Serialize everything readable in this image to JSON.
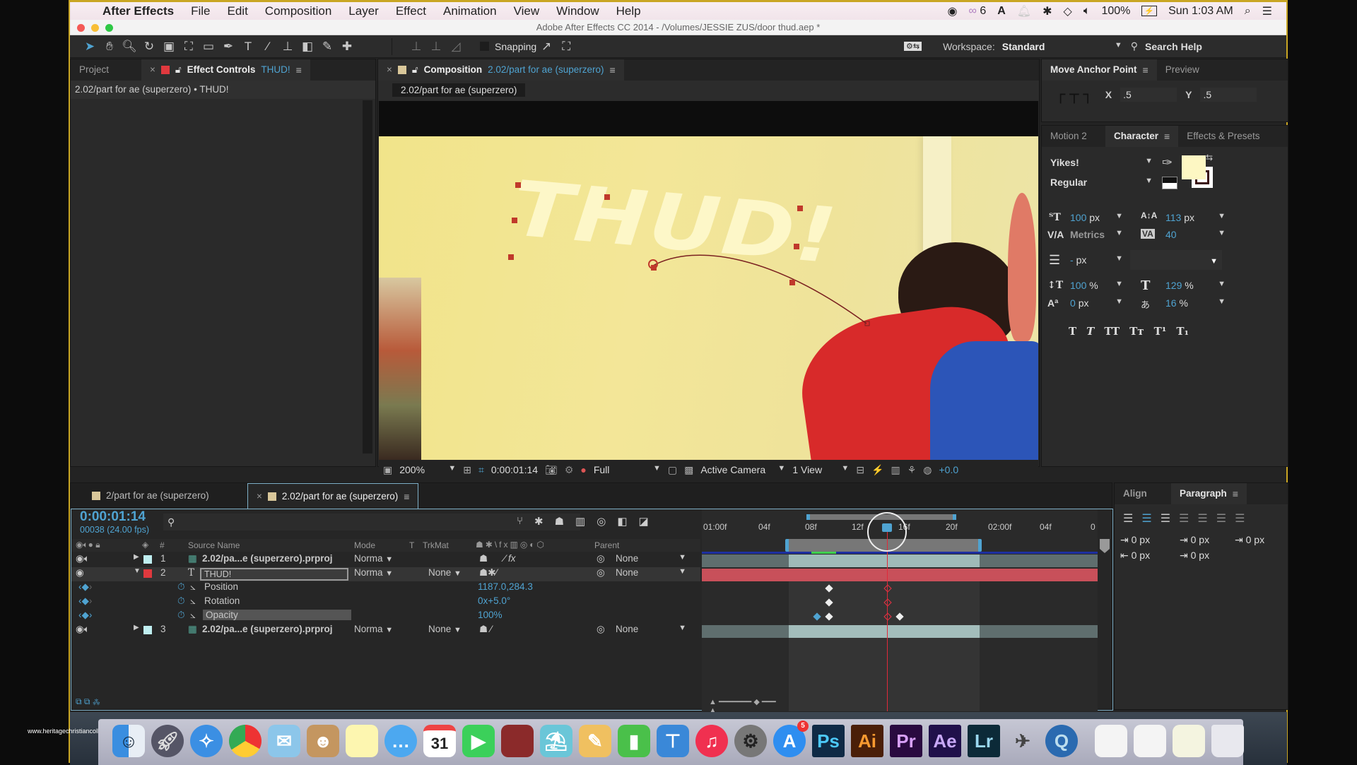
{
  "menubar": {
    "app_name": "After Effects",
    "items": [
      "File",
      "Edit",
      "Composition",
      "Layer",
      "Effect",
      "Animation",
      "View",
      "Window",
      "Help"
    ],
    "status": {
      "cc_count": "6",
      "battery": "100%",
      "clock": "Sun 1:03 AM"
    }
  },
  "window": {
    "title": "Adobe After Effects CC 2014 - /Volumes/JESSIE ZUS/door thud.aep *"
  },
  "toolbar": {
    "snapping_label": "Snapping",
    "workspace_label": "Workspace:",
    "workspace_value": "Standard",
    "search_help": "Search Help"
  },
  "left_panel": {
    "tab_project": "Project",
    "tab_effect_controls": "Effect Controls",
    "effect_controls_layer": "THUD!",
    "breadcrumb": "2.02/part for ae (superzero) • THUD!"
  },
  "composition": {
    "tab_label": "Composition",
    "comp_name": "2.02/part for ae (superzero)",
    "viewer_tab": "2.02/part for ae (superzero)",
    "overlay_text": "THUD!",
    "footer": {
      "zoom": "200%",
      "timecode": "0:00:01:14",
      "resolution": "Full",
      "camera": "Active Camera",
      "views": "1 View",
      "exposure": "+0.0"
    }
  },
  "right_panel": {
    "anchor_tab": "Move Anchor Point",
    "preview_tab": "Preview",
    "anchor_x_label": "X",
    "anchor_x": ".5",
    "anchor_y_label": "Y",
    "anchor_y": ".5",
    "tabs": [
      "Motion 2",
      "Character",
      "Effects & Presets"
    ],
    "character": {
      "font": "Yikes!",
      "style": "Regular",
      "fill_color": "#fdf7c3",
      "size": "100",
      "size_unit": "px",
      "leading": "113",
      "leading_unit": "px",
      "kerning": "Metrics",
      "tracking": "40",
      "stroke_width": "-",
      "stroke_unit": "px",
      "vscale": "100",
      "vscale_unit": "%",
      "hscale": "129",
      "hscale_unit": "%",
      "baseline": "0",
      "baseline_unit": "px",
      "tsume": "16",
      "tsume_unit": "%",
      "style_buttons": [
        "T",
        "T",
        "TT",
        "Tт",
        "T¹",
        "T₁"
      ]
    }
  },
  "timeline": {
    "tabs": [
      "2/part for ae (superzero)",
      "2.02/part for ae (superzero)"
    ],
    "current_time": "0:00:01:14",
    "frame_info": "00038 (24.00 fps)",
    "columns": {
      "source_name": "Source Name",
      "mode": "Mode",
      "t": "T",
      "trkmat": "TrkMat",
      "parent": "Parent",
      "num": "#"
    },
    "ruler": [
      "01:00f",
      "04f",
      "08f",
      "12f",
      "16f",
      "20f",
      "02:00f",
      "04f",
      "0"
    ],
    "layers": [
      {
        "num": "1",
        "name": "2.02/pa...e (superzero).prproj",
        "mode": "Norma",
        "trkmat": "",
        "parent": "None",
        "color": "#bfeef0"
      },
      {
        "num": "2",
        "name": "THUD!",
        "mode": "Norma",
        "trkmat": "None",
        "parent": "None",
        "color": "#e0393e"
      },
      {
        "num": "3",
        "name": "2.02/pa...e (superzero).prproj",
        "mode": "Norma",
        "trkmat": "None",
        "parent": "None",
        "color": "#bfeef0"
      }
    ],
    "properties": [
      {
        "name": "Position",
        "value": "1187.0,284.3"
      },
      {
        "name": "Rotation",
        "value": "0x+5.0°"
      },
      {
        "name": "Opacity",
        "value": "100%"
      }
    ]
  },
  "paragraph_panel": {
    "tabs": [
      "Align",
      "Paragraph"
    ],
    "indent_left": "0 px",
    "indent_right": "0 px",
    "indent_first": "0 px",
    "space_before": "0 px",
    "space_after": "0 px"
  },
  "dock": {
    "watermark": "www.heritagechristiancollege.com",
    "apps": [
      "Finder",
      "Launchpad",
      "Safari",
      "Chrome",
      "Mail",
      "Contacts",
      "Notes",
      "Messages",
      "Calendar",
      "FaceTime",
      "Photo Booth",
      "iPhoto",
      "Pages",
      "Numbers",
      "Keynote",
      "iTunes",
      "System Preferences",
      "App Store",
      "Ps",
      "Ai",
      "Pr",
      "Ae",
      "Lr",
      "Clean",
      "QuickTime",
      "Trash"
    ],
    "calendar_day": "31",
    "appstore_badge": "5"
  }
}
